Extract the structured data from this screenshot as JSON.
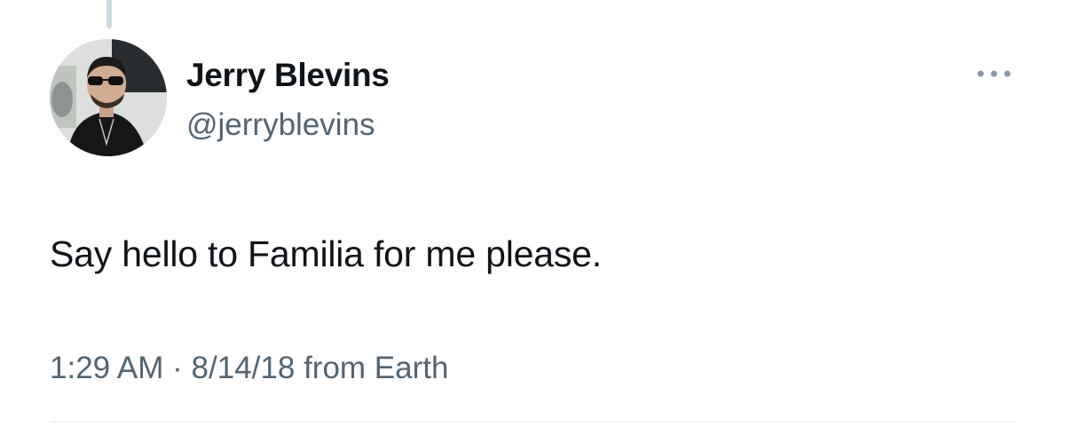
{
  "tweet": {
    "author": {
      "display_name": "Jerry Blevins",
      "handle": "@jerryblevins"
    },
    "text": "Say hello to Familia for me please.",
    "time": "1:29 AM",
    "separator": "·",
    "date": "8/14/18",
    "source": "from Earth"
  },
  "icons": {
    "more": "more-horizontal-icon",
    "avatar": "profile-photo"
  },
  "colors": {
    "text_primary": "#0f1419",
    "text_secondary": "#536471",
    "divider": "#eff3f4",
    "thread_line": "#cfd9de"
  }
}
